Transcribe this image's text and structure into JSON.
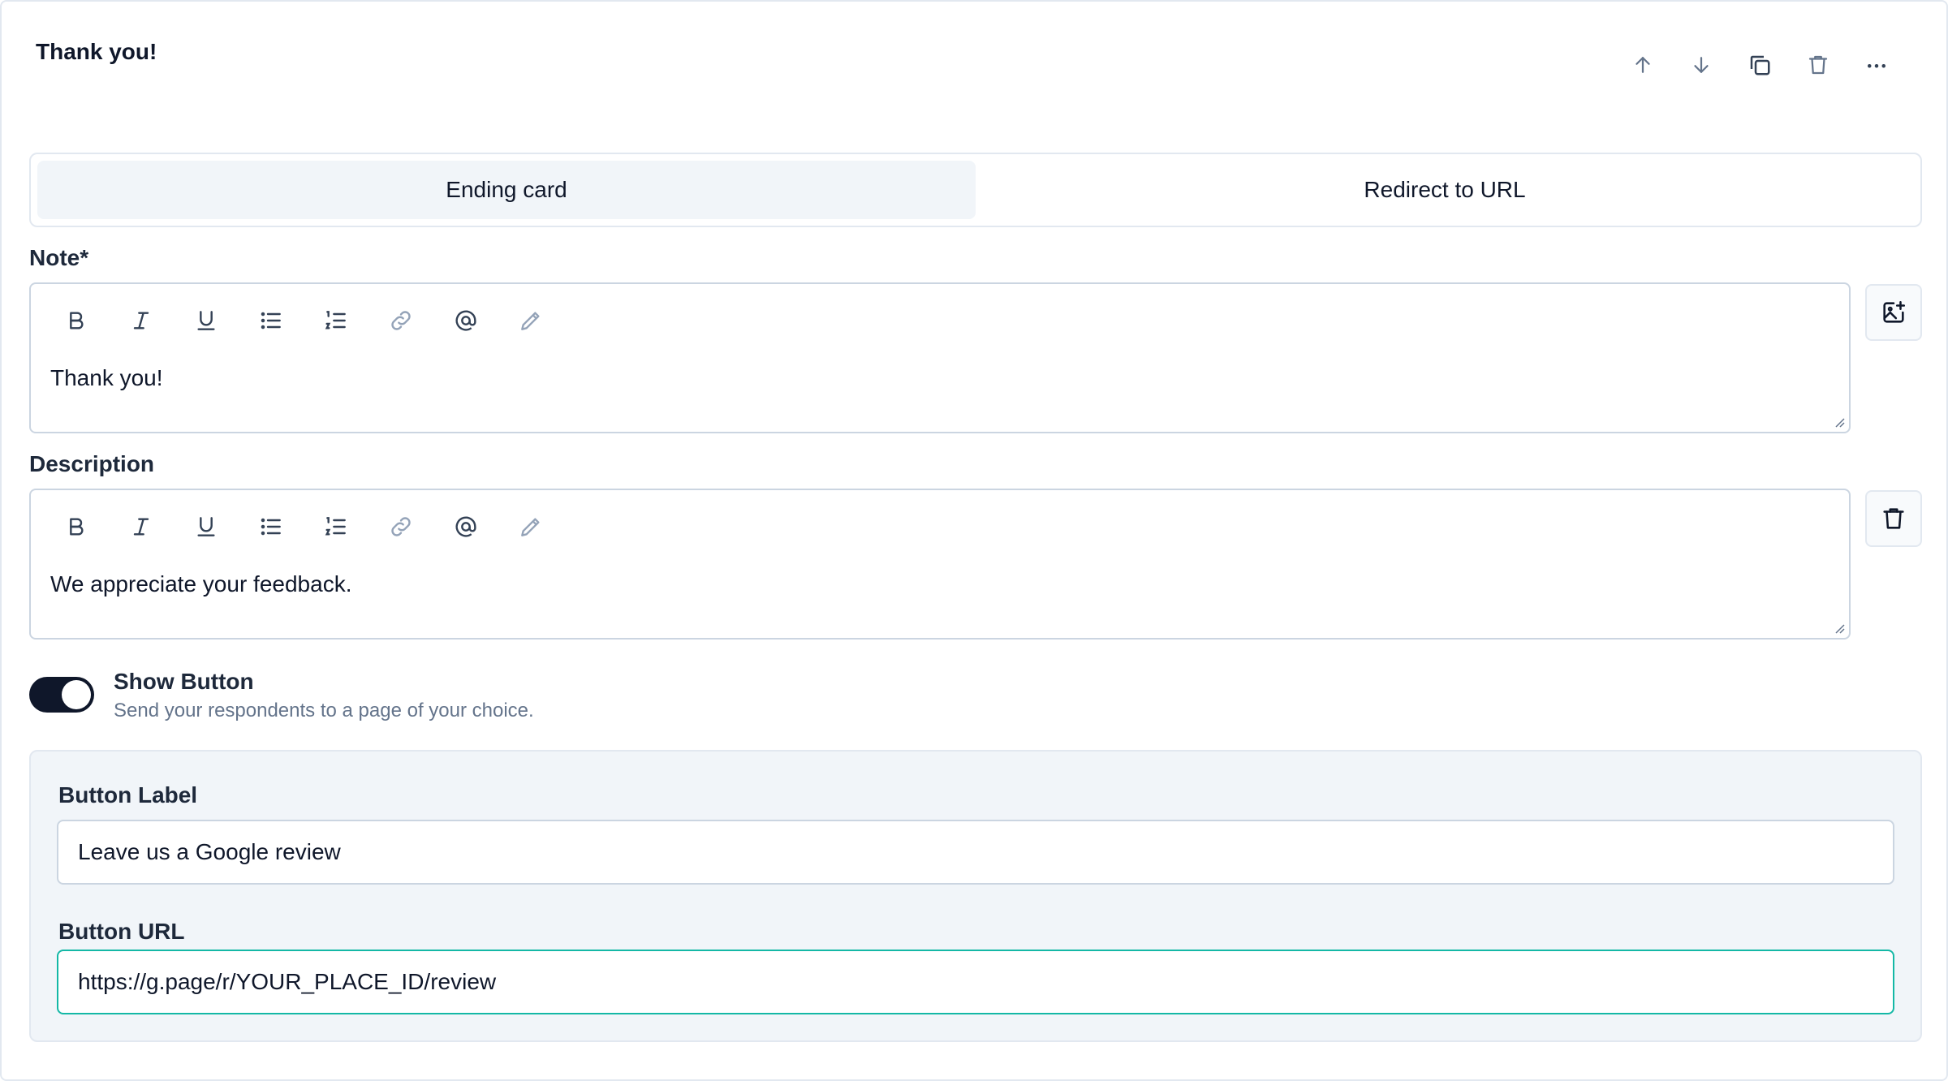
{
  "header": {
    "title": "Thank you!"
  },
  "actions": [
    {
      "name": "move-up-icon"
    },
    {
      "name": "move-down-icon"
    },
    {
      "name": "duplicate-icon"
    },
    {
      "name": "trash-icon"
    },
    {
      "name": "more-options-icon"
    }
  ],
  "tabs": {
    "ending_card": "Ending card",
    "redirect": "Redirect to URL",
    "active": "ending_card"
  },
  "note": {
    "label": "Note*",
    "value": "Thank you!"
  },
  "description": {
    "label": "Description",
    "value": "We appreciate your feedback."
  },
  "toolbar": [
    "bold-icon",
    "italic-icon",
    "underline-icon",
    "bullet-list-icon",
    "numbered-list-icon",
    "link-icon",
    "mention-icon",
    "edit-icon"
  ],
  "show_button": {
    "title": "Show Button",
    "description": "Send your respondents to a page of your choice.",
    "enabled": true
  },
  "button_label": {
    "label": "Button Label",
    "value": "Leave us a Google review"
  },
  "button_url": {
    "label": "Button URL",
    "value": "https://g.page/r/YOUR_PLACE_ID/review"
  },
  "colors": {
    "toggle_on": "#0f172a",
    "focus_ring": "#14b8a6",
    "panel_bg": "#f1f5f9"
  }
}
